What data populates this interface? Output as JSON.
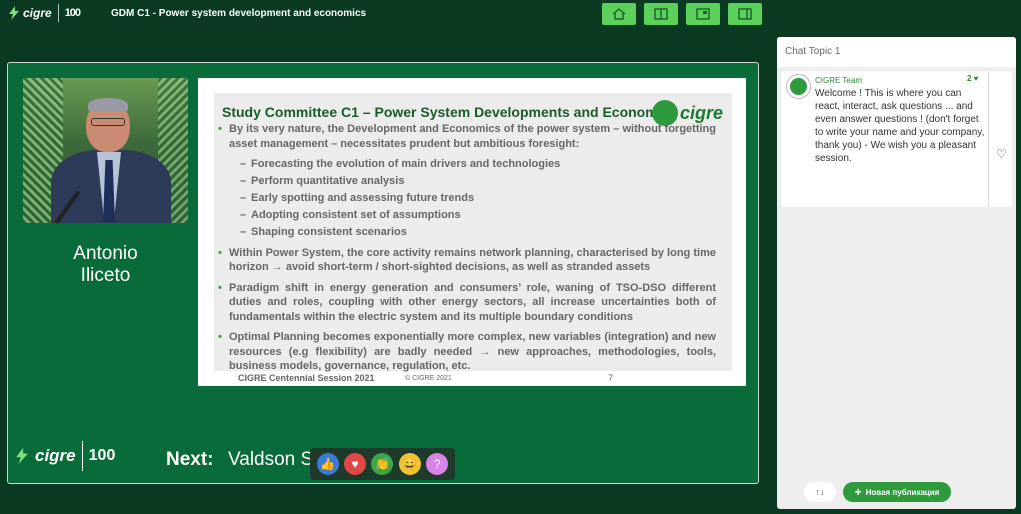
{
  "header": {
    "logo_text": "cigre",
    "logo_100": "100",
    "title": "GDM C1 - Power system development and economics",
    "buttons": [
      {
        "icon": "home-icon"
      },
      {
        "icon": "split-layout-icon"
      },
      {
        "icon": "picture-in-picture-icon"
      },
      {
        "icon": "sidebar-layout-icon"
      }
    ],
    "accent_color": "#5bd15b"
  },
  "stage": {
    "speaker_name_line1": "Antonio",
    "speaker_name_line2": "Iliceto",
    "slide": {
      "heading": "Study Committee C1 – Power System Developments and Economics",
      "logo": "cigre",
      "bullets": [
        {
          "text": "By its very nature, the Development and Economics of the power system – without forgetting asset management – necessitates prudent but ambitious foresight:",
          "subs": [
            "Forecasting the evolution of main drivers and technologies",
            "Perform quantitative analysis",
            "Early spotting and assessing future trends",
            "Adopting consistent set of assumptions",
            "Shaping consistent scenarios"
          ]
        },
        {
          "text": "Within Power System, the core activity remains network planning, characterised  by long time horizon → avoid short-term / short-sighted decisions, as well as stranded assets",
          "subs": []
        },
        {
          "text": "Paradigm shift in energy generation and consumers’ role, waning of TSO-DSO different duties and roles, coupling with other energy sectors, all increase uncertainties both of fundamentals within the electric system and its multiple boundary conditions",
          "subs": []
        },
        {
          "text": "Optimal Planning becomes exponentially more complex, new variables (integration) and new resources (e.g flexibility) are badly needed → new approaches, methodologies, tools, business models, governance, regulation, etc.",
          "subs": []
        }
      ],
      "footer": "CIGRE Centennial Session 2021",
      "copyright": "© CIGRE 2021",
      "page": "7"
    },
    "bottom_logo": "cigre",
    "bottom_logo_100": "100",
    "next_label": "Next:",
    "next_name": "Valdson Simoes",
    "reactions": [
      {
        "icon": "thumbs-up-icon",
        "glyph": "👍",
        "color": "#3a7bd5"
      },
      {
        "icon": "heart-icon",
        "glyph": "♥",
        "color": "#e04848"
      },
      {
        "icon": "clap-icon",
        "glyph": "👏",
        "color": "#3aa84a"
      },
      {
        "icon": "laugh-icon",
        "glyph": "😄",
        "color": "#f2c230"
      },
      {
        "icon": "question-icon",
        "glyph": "?",
        "color": "#d884e6"
      }
    ]
  },
  "chat": {
    "topic": "Chat Topic 1",
    "messages": [
      {
        "author": "CIGRE Team",
        "likes": "2 ♥",
        "text": "Welcome ! This is where you can react, interact, ask questions ... and even answer questions ! (don't forget to write your name and your company, thank you) - We wish you a pleasant session."
      }
    ],
    "sort_label": "↑↓",
    "new_post_label": "Новая публикация",
    "new_post_color": "#2f9a3c"
  }
}
